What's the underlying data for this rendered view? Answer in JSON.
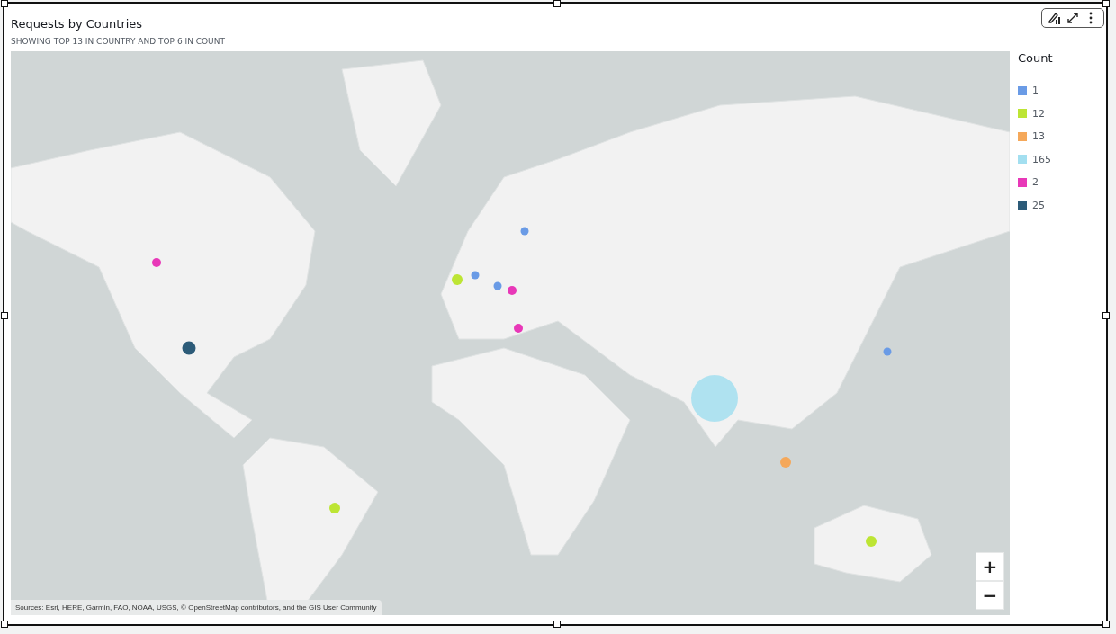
{
  "visual": {
    "title": "Requests by Countries",
    "subtitle": "SHOWING TOP 13 IN COUNTRY AND TOP 6 IN COUNT"
  },
  "map": {
    "attribution": "Sources: Esri, HERE, Garmin, FAO, NOAA, USGS, © OpenStreetMap contributors, and the GIS User Community",
    "zoom_in": "+",
    "zoom_out": "−"
  },
  "legend": {
    "title": "Count",
    "items": [
      {
        "label": "1",
        "color": "#6a9be6"
      },
      {
        "label": "12",
        "color": "#bde534"
      },
      {
        "label": "13",
        "color": "#f5a85a"
      },
      {
        "label": "165",
        "color": "#a3dff0"
      },
      {
        "label": "2",
        "color": "#e838b8"
      },
      {
        "label": "25",
        "color": "#2c5b78"
      }
    ]
  }
}
